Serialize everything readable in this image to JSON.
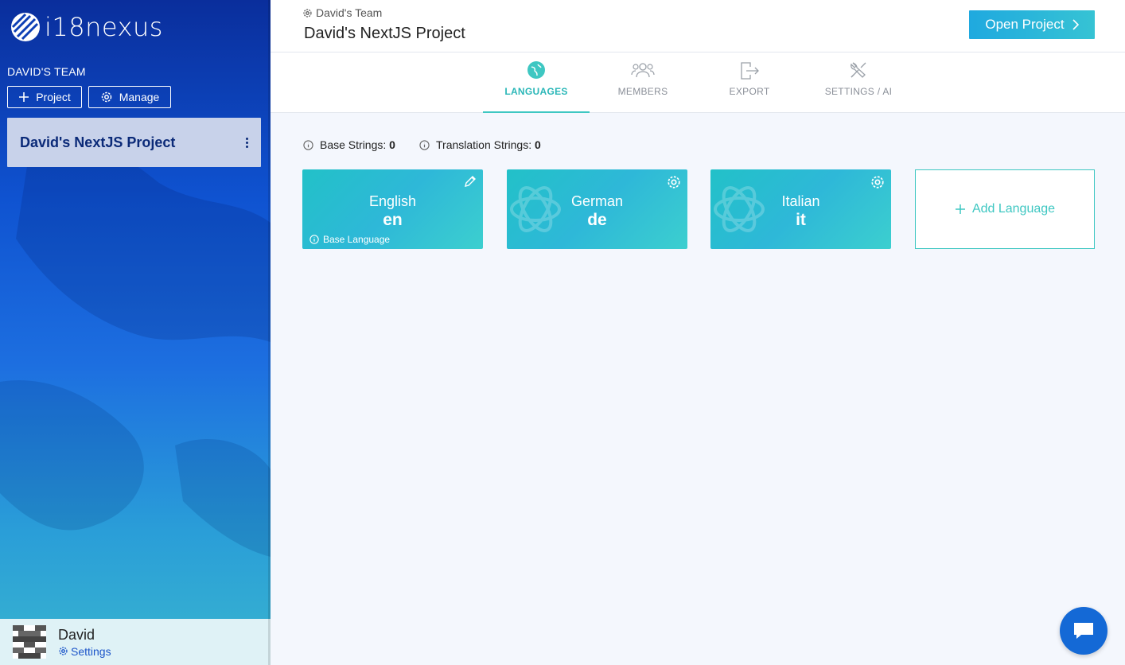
{
  "app": {
    "logo_text": "i18nexus"
  },
  "sidebar": {
    "team_label": "DAVID'S TEAM",
    "project_button": "Project",
    "manage_button": "Manage",
    "projects": [
      {
        "name": "David's NextJS Project"
      }
    ]
  },
  "user": {
    "name": "David",
    "settings_label": "Settings"
  },
  "header": {
    "breadcrumb": "David's Team",
    "title": "David's NextJS Project",
    "open_button": "Open Project"
  },
  "tabs": [
    {
      "label": "LANGUAGES",
      "icon": "globe-icon",
      "active": true
    },
    {
      "label": "MEMBERS",
      "icon": "members-icon",
      "active": false
    },
    {
      "label": "EXPORT",
      "icon": "export-icon",
      "active": false
    },
    {
      "label": "SETTINGS / AI",
      "icon": "tools-icon",
      "active": false
    }
  ],
  "stats": {
    "base_label": "Base Strings:",
    "base_value": "0",
    "translation_label": "Translation Strings:",
    "translation_value": "0"
  },
  "languages": [
    {
      "name": "English",
      "code": "en",
      "base_label": "Base Language",
      "icon": "pencil-icon"
    },
    {
      "name": "German",
      "code": "de",
      "icon": "gear-icon"
    },
    {
      "name": "Italian",
      "code": "it",
      "icon": "gear-icon"
    }
  ],
  "add_language": {
    "label": "Add Language"
  },
  "colors": {
    "accent": "#3ec7c2",
    "sidebar_top": "#0a2e9c",
    "button_blue": "#1fa9df",
    "chat": "#1469d6"
  }
}
